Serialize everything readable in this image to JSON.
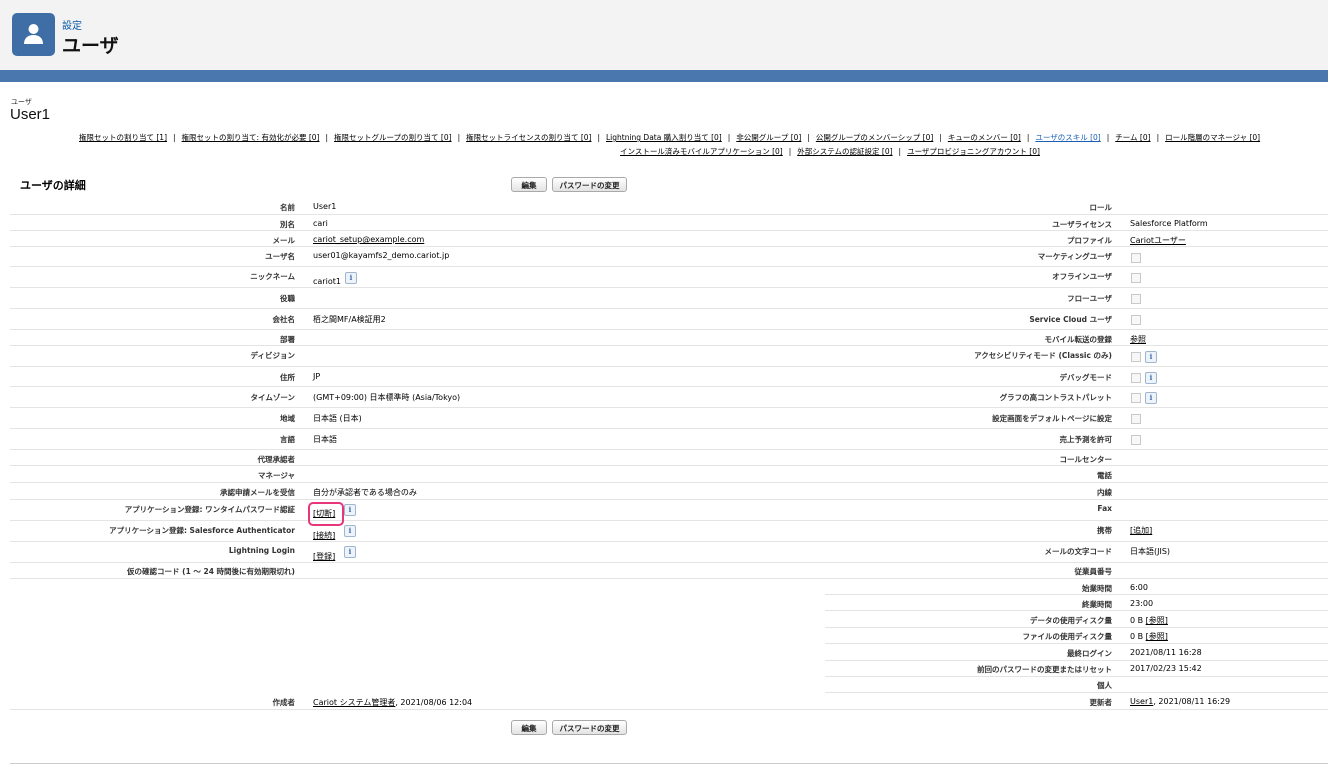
{
  "header": {
    "breadcrumb": "設定",
    "title": "ユーザ"
  },
  "object": {
    "type_label": "ユーザ",
    "name": "User1"
  },
  "related_links": {
    "line1": [
      {
        "label": "権限セットの割り当て [1]"
      },
      {
        "label": "権限セットの割り当て: 有効化が必要 [0]"
      },
      {
        "label": "権限セットグループの割り当て [0]"
      },
      {
        "label": "権限セットライセンスの割り当て [0]"
      },
      {
        "label": "Lightning Data 購入割り当て [0]"
      },
      {
        "label": "非公開グループ [0]"
      },
      {
        "label": "公開グループのメンバーシップ [0]"
      },
      {
        "label": "キューのメンバー [0]"
      },
      {
        "label": "ユーザのスキル [0]"
      },
      {
        "label": "チーム [0]"
      },
      {
        "label": "ロール階層のマネージャ [0]"
      }
    ],
    "line2": [
      {
        "label": "インストール済みモバイルアプリケーション [0]"
      },
      {
        "label": "外部システムの認証設定 [0]"
      },
      {
        "label": "ユーザプロビジョニングアカウント [0]"
      }
    ]
  },
  "section": {
    "title": "ユーザの詳細"
  },
  "buttons": {
    "edit": "編集",
    "change_password": "パスワードの変更"
  },
  "info_glyph": "i",
  "left_fields": {
    "name": {
      "label": "名前",
      "value": "User1"
    },
    "alias": {
      "label": "別名",
      "value": "cari"
    },
    "email": {
      "label": "メール",
      "value": "cariot_setup@example.com"
    },
    "username": {
      "label": "ユーザ名",
      "value": "user01@kayamfs2_demo.cariot.jp"
    },
    "nickname": {
      "label": "ニックネーム",
      "value": "cariot1"
    },
    "title": {
      "label": "役職",
      "value": ""
    },
    "company": {
      "label": "会社名",
      "value": "栢之間MF/A検証用2"
    },
    "department": {
      "label": "部署",
      "value": ""
    },
    "division": {
      "label": "ディビジョン",
      "value": ""
    },
    "address": {
      "label": "住所",
      "value": "JP"
    },
    "timezone": {
      "label": "タイムゾーン",
      "value": "(GMT+09:00) 日本標準時 (Asia/Tokyo)"
    },
    "locale": {
      "label": "地域",
      "value": "日本語 (日本)"
    },
    "language": {
      "label": "言語",
      "value": "日本語"
    },
    "delegated_approver": {
      "label": "代理承認者",
      "value": ""
    },
    "manager": {
      "label": "マネージャ",
      "value": ""
    },
    "approval_email": {
      "label": "承認申請メールを受信",
      "value": "自分が承認者である場合のみ"
    },
    "otp": {
      "label": "アプリケーション登録: ワンタイムパスワード認証",
      "value": "[切断]"
    },
    "sf_auth": {
      "label": "アプリケーション登録: Salesforce Authenticator",
      "value": "[接続]"
    },
    "lightning_login": {
      "label": "Lightning Login",
      "value": "[登録]"
    },
    "temp_code": {
      "label": "仮の確認コード (1 ～ 24 時間後に有効期限切れ)",
      "value": ""
    },
    "created_by": {
      "label": "作成者",
      "value_link": "Cariot システム管理者",
      "value_rest": ", 2021/08/06 12:04"
    }
  },
  "right_fields": {
    "role": {
      "label": "ロール",
      "value": ""
    },
    "user_license": {
      "label": "ユーザライセンス",
      "value": "Salesforce Platform"
    },
    "profile": {
      "label": "プロファイル",
      "value": "Cariotユーザー"
    },
    "marketing_user": {
      "label": "マーケティングユーザ"
    },
    "offline_user": {
      "label": "オフラインユーザ"
    },
    "flow_user": {
      "label": "フローユーザ"
    },
    "service_cloud_user": {
      "label": "Service Cloud ユーザ"
    },
    "mobile_push": {
      "label": "モバイル転送の登録",
      "value": "参照"
    },
    "accessibility": {
      "label": "アクセシビリティモード (Classic のみ)"
    },
    "debug_mode": {
      "label": "デバッグモード"
    },
    "high_contrast": {
      "label": "グラフの高コントラストパレット"
    },
    "default_setup": {
      "label": "設定画面をデフォルトページに設定"
    },
    "allow_forecast": {
      "label": "売上予測を許可"
    },
    "call_center": {
      "label": "コールセンター",
      "value": ""
    },
    "phone": {
      "label": "電話",
      "value": ""
    },
    "extension": {
      "label": "内線",
      "value": ""
    },
    "fax": {
      "label": "Fax",
      "value": ""
    },
    "mobile": {
      "label": "携帯",
      "value": "[追加]"
    },
    "email_encoding": {
      "label": "メールの文字コード",
      "value": "日本語(JIS)"
    },
    "employee_number": {
      "label": "従業員番号",
      "value": ""
    },
    "start_of_day": {
      "label": "始業時間",
      "value": "6:00"
    },
    "end_of_day": {
      "label": "終業時間",
      "value": "23:00"
    },
    "data_space": {
      "label": "データの使用ディスク量",
      "value": "0 B",
      "link": "[参照]"
    },
    "file_space": {
      "label": "ファイルの使用ディスク量",
      "value": "0 B",
      "link": "[参照]"
    },
    "last_login": {
      "label": "最終ログイン",
      "value": "2021/08/11 16:28"
    },
    "last_password_change": {
      "label": "前回のパスワードの変更またはリセット",
      "value": "2017/02/23 15:42"
    },
    "individual": {
      "label": "個人",
      "value": ""
    },
    "modified_by": {
      "label": "更新者",
      "value_link": "User1",
      "value_rest": ", 2021/08/11 16:29"
    }
  },
  "colors": {
    "header_bg": "#f3f3f3",
    "band": "#4a77ad",
    "icon_bg": "#3f6ea7",
    "highlight": "#e8367a",
    "link_active": "#1a5fb4"
  }
}
